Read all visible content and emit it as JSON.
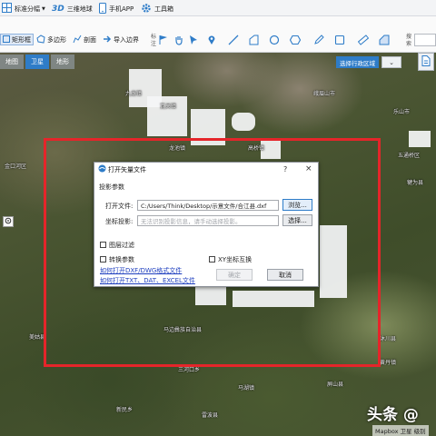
{
  "toolbar_top": {
    "split_label": "标准分幅",
    "globe_badge": "3D",
    "globe_label": "三维地球",
    "mobile_label": "手机APP",
    "toolbox_label": "工具箱"
  },
  "toolbar_main": {
    "rect_label": "矩形框",
    "polygon_label": "多边形",
    "profile_label": "剖面",
    "import_label": "导入边界",
    "mark_group": [
      "标",
      "注"
    ],
    "search_group": [
      "搜",
      "索"
    ]
  },
  "map": {
    "tabs": [
      "地图",
      "卫星",
      "地形"
    ],
    "active_tab": "卫星",
    "region_button": "选择行政区域",
    "labels": [
      {
        "text": "九龙镇",
        "cls": "l1"
      },
      {
        "text": "瓦关镇",
        "cls": "l2"
      },
      {
        "text": "峨眉山市",
        "cls": "l3"
      },
      {
        "text": "乐山市",
        "cls": "l4"
      },
      {
        "text": "龙池镇",
        "cls": "l5"
      },
      {
        "text": "高桥镇",
        "cls": "l6"
      },
      {
        "text": "金口河区",
        "cls": "l7"
      },
      {
        "text": "五通桥区",
        "cls": "l8"
      },
      {
        "text": "犍为县",
        "cls": "l9"
      },
      {
        "text": "马边彝族自治县",
        "cls": "l10"
      },
      {
        "text": "沐川县",
        "cls": "l11"
      },
      {
        "text": "三河口乡",
        "cls": "l12"
      },
      {
        "text": "屏山县",
        "cls": "l13"
      },
      {
        "text": "马湖镇",
        "cls": "l14"
      },
      {
        "text": "美姑县",
        "cls": "l15"
      },
      {
        "text": "黄丹镇",
        "cls": "l16"
      },
      {
        "text": "新民乡",
        "cls": "l17"
      },
      {
        "text": "雷波县",
        "cls": "l18"
      }
    ]
  },
  "dialog": {
    "title": "打开矢量文件",
    "help": "?",
    "close": "×",
    "section": "投影参数",
    "file_label": "打开文件:",
    "file_value": "C:/Users/Think/Desktop/示意文件/合江县.dxf",
    "browse_button": "浏览...",
    "proj_label": "坐标投影:",
    "proj_placeholder": "无法识别投影信息，请手动选择投影。",
    "select_button": "选择...",
    "layer_filter": "图层过滤",
    "convert_params": "转换参数",
    "xy_swap": "XY坐标互换",
    "ok_button": "确定",
    "cancel_button": "取消",
    "link1": "如何打开DXF/DWG格式文件",
    "link2": "如何打开TXT、DAT、EXCEL文件"
  },
  "footer": {
    "watermark": "头条 @",
    "attribution": "Mapbox 卫星  级别"
  },
  "colors": {
    "accent": "#2e7cc8",
    "highlight_box": "#e5252a",
    "link": "#1f3fbf"
  },
  "icons": [
    "grid-icon",
    "globe-icon",
    "mobile-icon",
    "gear-icon",
    "polygon-icon",
    "profile-icon",
    "import-icon",
    "flag-icon",
    "pan-hand-icon",
    "pointer-icon",
    "pin-icon",
    "line-icon",
    "corner-icon",
    "circle-icon",
    "hexagon-icon",
    "pen-icon",
    "square-icon",
    "ruler-icon",
    "area-measure-icon",
    "vector-file-icon",
    "target-icon"
  ]
}
